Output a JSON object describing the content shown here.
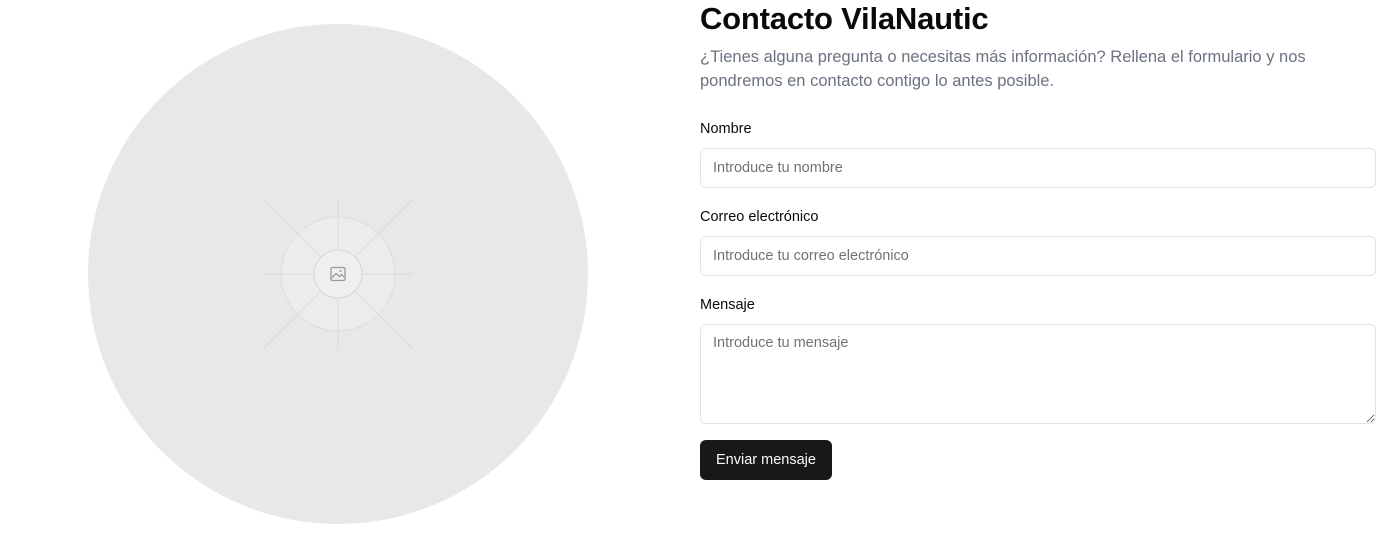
{
  "contact": {
    "title": "Contacto VilaNautic",
    "subtitle": "¿Tienes alguna pregunta o necesitas más información? Rellena el formulario y nos pondremos en contacto contigo lo antes posible."
  },
  "form": {
    "name_label": "Nombre",
    "name_placeholder": "Introduce tu nombre",
    "email_label": "Correo electrónico",
    "email_placeholder": "Introduce tu correo electrónico",
    "message_label": "Mensaje",
    "message_placeholder": "Introduce tu mensaje",
    "submit_label": "Enviar mensaje"
  },
  "image": {
    "icon": "image-icon"
  },
  "colors": {
    "placeholder_bg": "#e8e8e8",
    "button_bg": "#18181b",
    "muted_text": "#6b7280",
    "border": "#e4e4e7"
  }
}
